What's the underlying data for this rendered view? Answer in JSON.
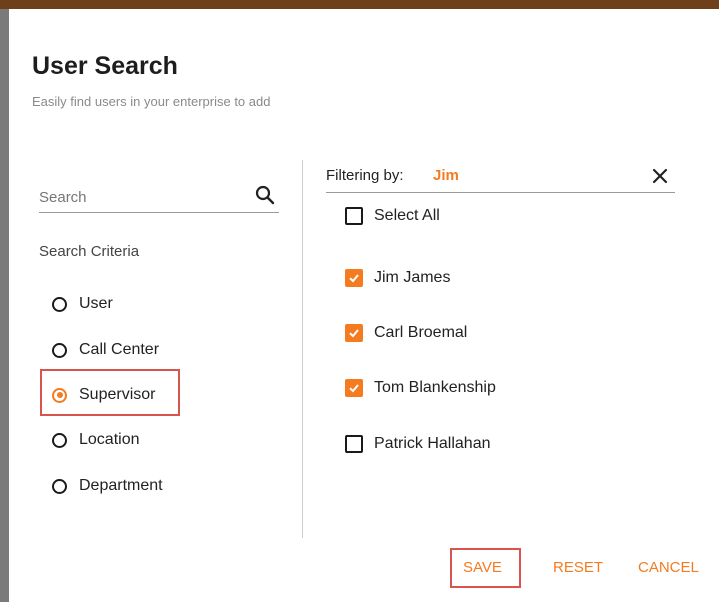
{
  "dialog": {
    "title": "User Search",
    "subtitle": "Easily find users in your enterprise to add"
  },
  "search": {
    "placeholder": "Search",
    "value": "",
    "icon": "search-icon"
  },
  "criteria": {
    "label": "Search Criteria",
    "options": [
      {
        "label": "User",
        "selected": false
      },
      {
        "label": "Call Center",
        "selected": false
      },
      {
        "label": "Supervisor",
        "selected": true
      },
      {
        "label": "Location",
        "selected": false
      },
      {
        "label": "Department",
        "selected": false
      }
    ]
  },
  "filter": {
    "label": "Filtering by:",
    "value": "Jim",
    "clear_icon": "close-icon"
  },
  "results": {
    "select_all_label": "Select All",
    "select_all_checked": false,
    "items": [
      {
        "label": "Jim James",
        "checked": true
      },
      {
        "label": "Carl Broemal",
        "checked": true
      },
      {
        "label": "Tom Blankenship",
        "checked": true
      },
      {
        "label": "Patrick Hallahan",
        "checked": false
      }
    ]
  },
  "actions": {
    "save_label": "SAVE",
    "reset_label": "RESET",
    "cancel_label": "CANCEL"
  },
  "colors": {
    "accent": "#f47b20",
    "highlight_border": "#d9534f"
  }
}
